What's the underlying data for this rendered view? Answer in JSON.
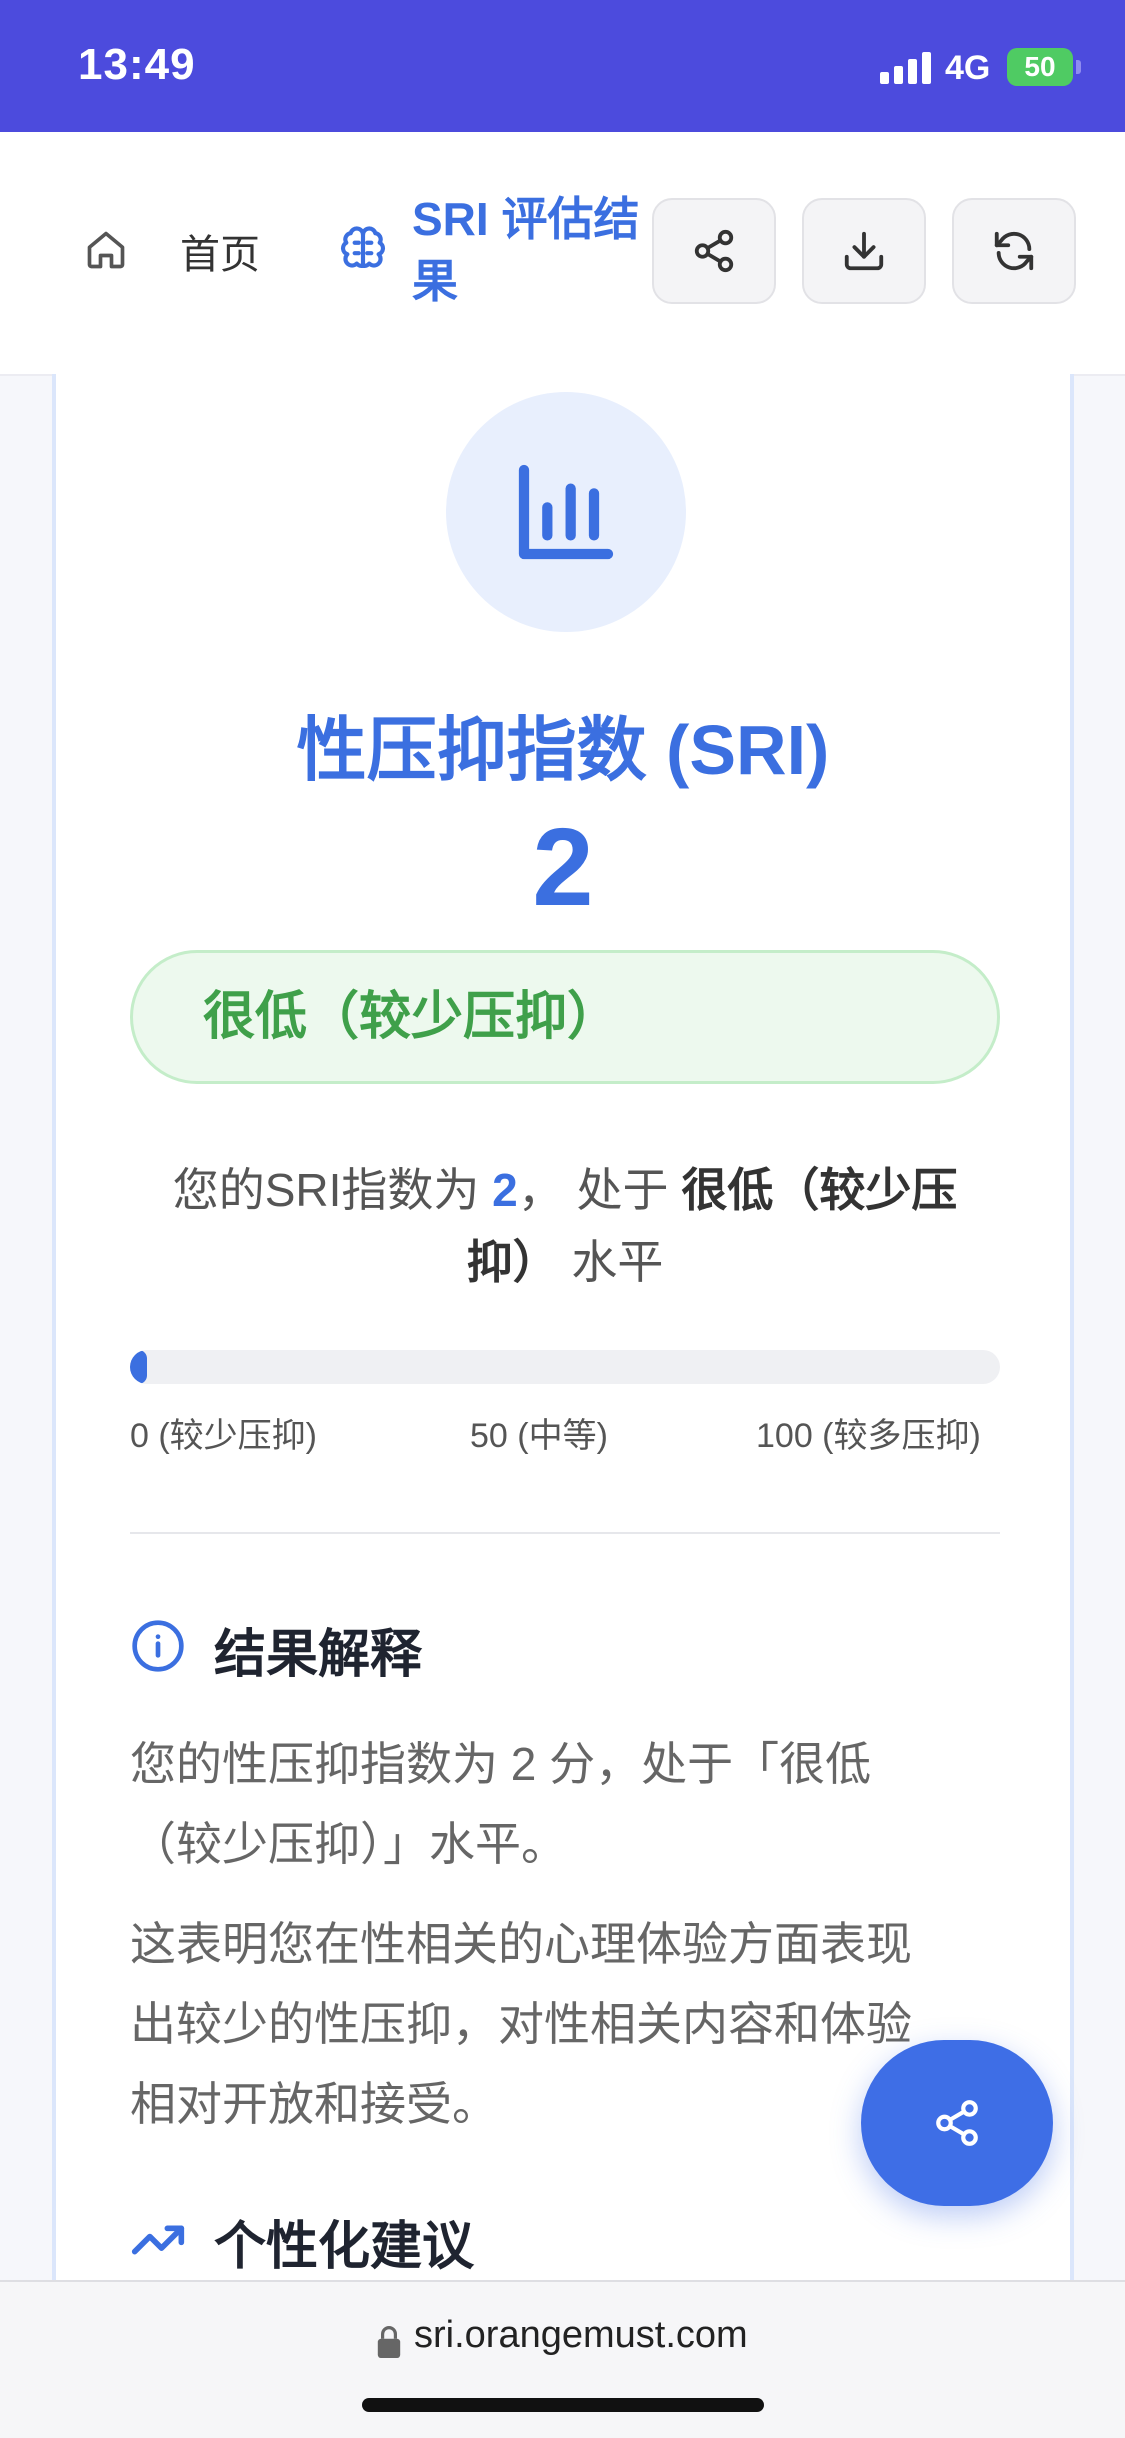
{
  "status_bar": {
    "time": "13:49",
    "network": "4G",
    "battery": "50"
  },
  "nav": {
    "home_label": "首页",
    "title_line1": "SRI 评估结",
    "title_line2": "果",
    "buttons": [
      "share-icon",
      "download-icon",
      "refresh-icon"
    ]
  },
  "result": {
    "title": "性压抑指数 (SRI)",
    "score": "2",
    "level": "很低（较少压抑）",
    "summary": {
      "prefix": "您的SRI指数为 ",
      "score": "2",
      "middle": "， 处于 ",
      "level_line1": "很低（较少压",
      "level_line2": "抑）",
      "suffix": " 水平"
    },
    "progress_percent": 2,
    "scale": {
      "low": "0 (较少压抑)",
      "mid": "50 (中等)",
      "high": "100 (较多压抑)"
    }
  },
  "interpretation": {
    "heading": "结果解释",
    "para1_line1": "您的性压抑指数为 2 分，处于「很低",
    "para1_line2": "（较少压抑）」水平。",
    "para2_line1": "这表明您在性相关的心理体验方面表现",
    "para2_line2": "出较少的性压抑，对性相关内容和体验",
    "para2_line3": "相对开放和接受。"
  },
  "advice": {
    "heading": "个性化建议"
  },
  "browser": {
    "url": "sri.orangemust.com"
  },
  "colors": {
    "accent": "#3b6fe0",
    "status_bar": "#4c4bdd",
    "level_green": "#3fa04a"
  }
}
